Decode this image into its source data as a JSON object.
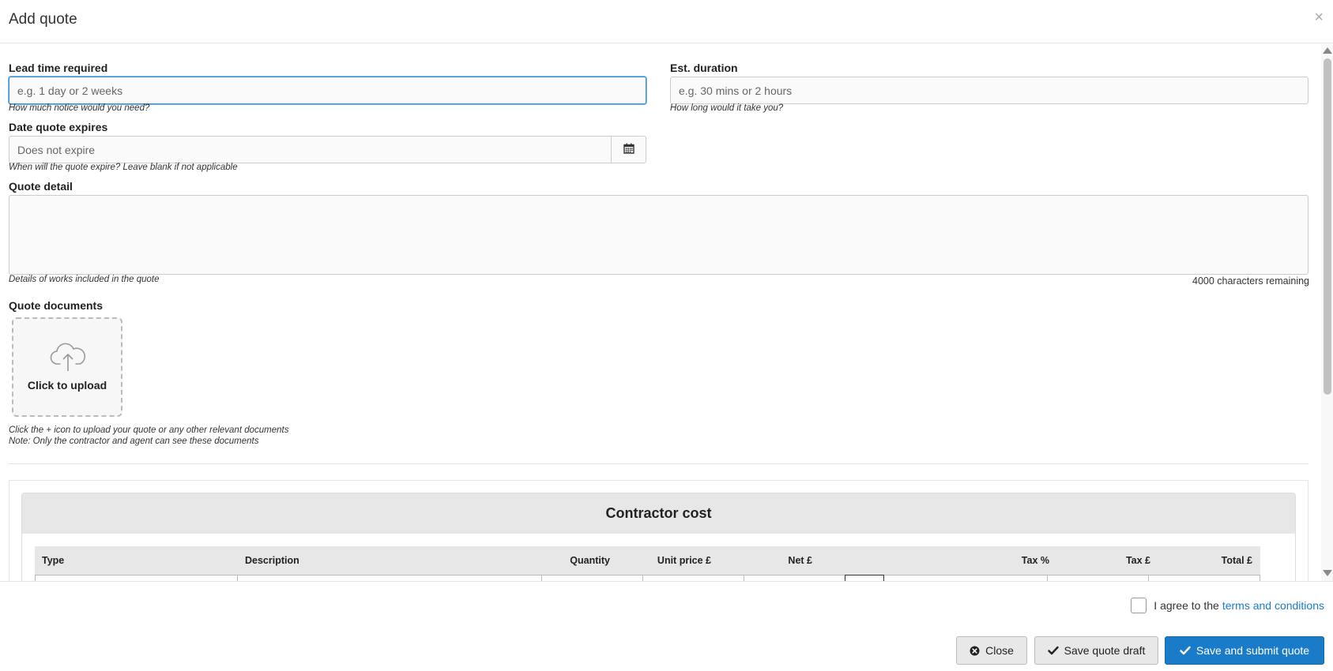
{
  "dialog": {
    "title": "Add quote",
    "close_glyph": "×"
  },
  "form": {
    "lead_time": {
      "label": "Lead time required",
      "placeholder": "e.g. 1 day or 2 weeks",
      "help": "How much notice would you need?"
    },
    "est_duration": {
      "label": "Est. duration",
      "placeholder": "e.g. 30 mins or 2 hours",
      "help": "How long would it take you?"
    },
    "date_expires": {
      "label": "Date quote expires",
      "placeholder": "Does not expire",
      "help": "When will the quote expire? Leave blank if not applicable",
      "icon": "calendar-icon"
    },
    "quote_detail": {
      "label": "Quote detail",
      "value": "",
      "help": "Details of works included in the quote",
      "remaining": "4000 characters remaining"
    },
    "documents": {
      "label": "Quote documents",
      "upload_label": "Click to upload",
      "upload_icon": "cloud-upload-icon",
      "help_line1": "Click the + icon to upload your quote or any other relevant documents",
      "help_line2": "Note: Only the contractor and agent can see these documents"
    }
  },
  "contractor_cost": {
    "title": "Contractor cost",
    "columns": [
      "Type",
      "Description",
      "Quantity",
      "Unit price £",
      "Net £",
      "Tax %",
      "Tax £",
      "Total £"
    ]
  },
  "footer": {
    "agree_text": "I agree to the",
    "terms_link": "terms and conditions",
    "agree_checked": false,
    "close_label": "Close",
    "draft_label": "Save quote draft",
    "submit_label": "Save and submit quote"
  },
  "colors": {
    "primary": "#1a7cc9",
    "link": "#1b7bc4",
    "focus": "#3a8fd6"
  }
}
